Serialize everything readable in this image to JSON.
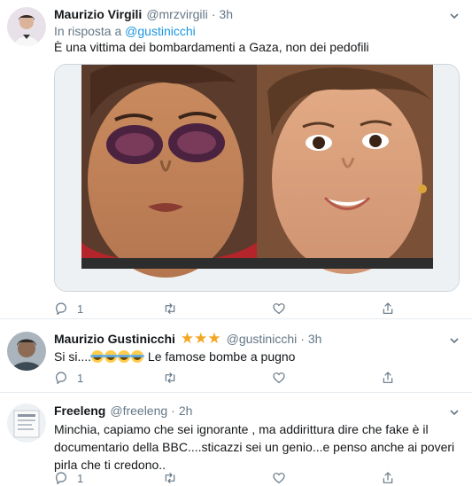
{
  "tweets": [
    {
      "name": "Maurizio Virgili",
      "handle": "@mrzvirgili",
      "dot": "·",
      "time": "3h",
      "reply_prefix": "In risposta a",
      "reply_handle": "@gustinicchi",
      "text": "È una vittima dei bombardamenti a Gaza, non dei pedofili",
      "actions": {
        "reply_count": "1",
        "retweet_count": "",
        "like_count": ""
      }
    },
    {
      "name": "Maurizio Gustinicchi",
      "stars": "★★★",
      "handle": "@gustinicchi",
      "dot": "·",
      "time": "3h",
      "text_prefix": "Si si....",
      "text_suffix": " Le famose bombe a pugno",
      "actions": {
        "reply_count": "1",
        "retweet_count": "",
        "like_count": ""
      }
    },
    {
      "name": "Freeleng",
      "handle": "@freeleng",
      "dot": "·",
      "time": "2h",
      "text": "Minchia, capiamo che sei ignorante , ma addirittura dire che fake è il documentario della BBC....sticazzi sei un genio...e penso anche ai poveri pirla che ti credono..",
      "actions": {
        "reply_count": "1",
        "retweet_count": "",
        "like_count": ""
      }
    }
  ],
  "colors": {
    "name": "#14171a",
    "meta": "#657786",
    "link": "#1b95e0",
    "star": "#f4a622",
    "divider": "#e6ecf0"
  },
  "icons": [
    "caret-down-icon",
    "reply-icon",
    "retweet-icon",
    "like-icon",
    "share-icon"
  ]
}
